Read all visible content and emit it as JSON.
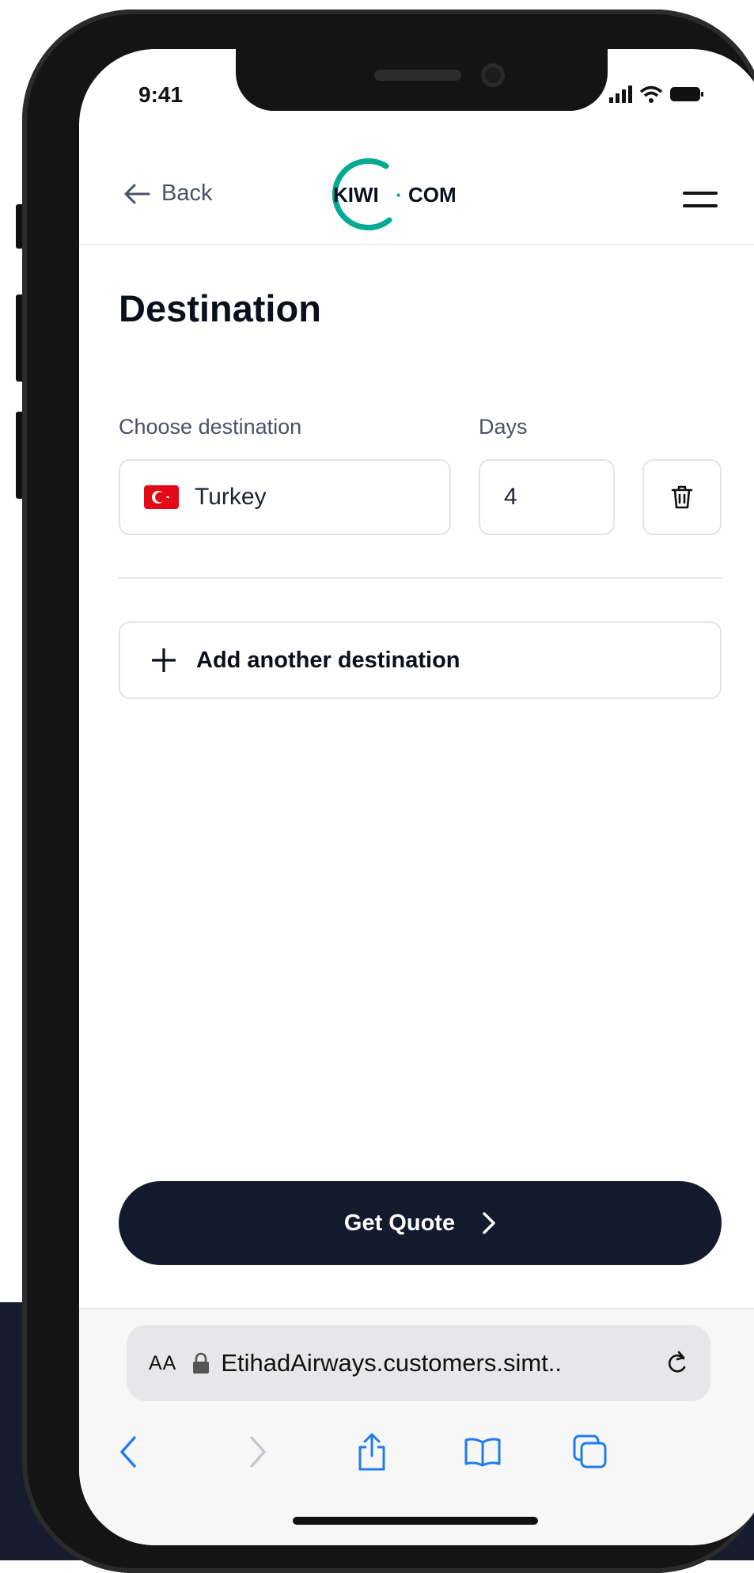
{
  "status_bar": {
    "time": "9:41"
  },
  "header": {
    "back_label": "Back",
    "logo_left": "KIWI",
    "logo_dot": "·",
    "logo_right": "COM"
  },
  "page": {
    "title": "Destination"
  },
  "form": {
    "destination_label": "Choose destination",
    "destination_value": "Turkey",
    "days_label": "Days",
    "days_value": "4"
  },
  "add_destination_label": "Add another destination",
  "cta_label": "Get Quote",
  "browser": {
    "aa_label": "AA",
    "url": "EtihadAirways.customers.simt.."
  },
  "colors": {
    "brand_accent": "#00a991",
    "cta_background": "#141a2d",
    "browser_blue": "#1d7cf2",
    "flag_red": "#e30a17"
  },
  "icons": [
    "back-arrow-icon",
    "menu-icon",
    "turkey-flag-icon",
    "trash-icon",
    "plus-icon",
    "chevron-right-icon",
    "lock-icon",
    "reload-icon",
    "browser-back-icon",
    "browser-forward-icon",
    "share-icon",
    "bookmarks-icon",
    "tabs-icon"
  ]
}
